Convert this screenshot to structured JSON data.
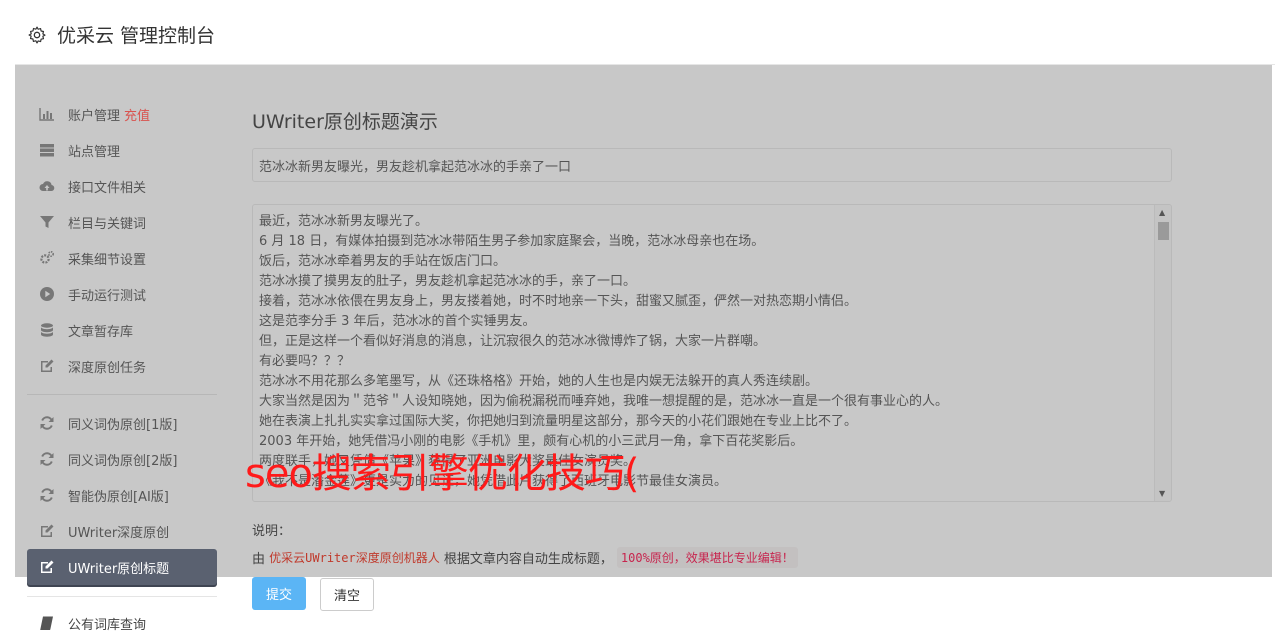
{
  "header": {
    "title": "优采云 管理控制台",
    "icon": "gear-icon"
  },
  "sidebar": {
    "groups": [
      [
        {
          "label": "账户管理",
          "badge": "充值",
          "icon": "bar-chart-icon"
        },
        {
          "label": "站点管理",
          "icon": "server-icon"
        },
        {
          "label": "接口文件相关",
          "icon": "cloud-upload-icon"
        },
        {
          "label": "栏目与关键词",
          "icon": "filter-icon"
        },
        {
          "label": "采集细节设置",
          "icon": "cogs-icon"
        },
        {
          "label": "手动运行测试",
          "icon": "play-circle-icon"
        },
        {
          "label": "文章暂存库",
          "icon": "database-icon"
        },
        {
          "label": "深度原创任务",
          "icon": "edit-icon"
        }
      ],
      [
        {
          "label": "同义词伪原创[1版]",
          "icon": "refresh-icon"
        },
        {
          "label": "同义词伪原创[2版]",
          "icon": "refresh-icon"
        },
        {
          "label": "智能伪原创[AI版]",
          "icon": "refresh-icon"
        },
        {
          "label": "UWriter深度原创",
          "icon": "edit-icon"
        },
        {
          "label": "UWriter原创标题",
          "icon": "edit-icon",
          "active": true
        }
      ]
    ],
    "bottom": {
      "label": "公有词库查询",
      "icon": "book-icon"
    }
  },
  "main": {
    "page_title": "UWriter原创标题演示",
    "title_value": "范冰冰新男友曝光，男友趁机拿起范冰冰的手亲了一口",
    "body_lines": [
      "最近，范冰冰新男友曝光了。",
      "6 月 18 日，有媒体拍摄到范冰冰带陌生男子参加家庭聚会，当晚，范冰冰母亲也在场。",
      "饭后，范冰冰牵着男友的手站在饭店门口。",
      "范冰冰摸了摸男友的肚子，男友趁机拿起范冰冰的手，亲了一口。",
      "接着，范冰冰依偎在男友身上，男友搂着她，时不时地亲一下头，甜蜜又腻歪，俨然一对热恋期小情侣。",
      "这是范李分手 3 年后，范冰冰的首个实锤男友。",
      "但，正是这样一个看似好消息的消息，让沉寂很久的范冰冰微博炸了锅，大家一片群嘲。",
      "有必要吗？？？",
      "范冰冰不用花那么多笔墨写，从《还珠格格》开始，她的人生也是内娱无法躲开的真人秀连续剧。",
      "大家当然是因为＂范爷＂人设知晓她，因为偷税漏税而唾弃她，我唯一想提醒的是，范冰冰一直是一个很有事业心的人。",
      "她在表演上扎扎实实拿过国际大奖，你把她归到流量明星这部分，那今天的小花们跟她在专业上比不了。",
      "2003 年开始，她凭借冯小刚的电影《手机》里，颇有心机的小三武月一角，拿下百花奖影后。",
      "两度联手，她又凭借《苹果》获得了亚洲电影大奖最佳女演员奖。",
      "《我不是潘金莲》更是实力的见证，她凭借此片获得了西班牙电影节最佳女演员。"
    ],
    "watermark": "seo搜索引擎优化技巧(",
    "note_label": "说明：",
    "note_prefix": "由",
    "note_highlight": "优采云UWriter深度原创机器人",
    "note_middle": "根据文章内容自动生成标题，",
    "note_code": "100%原创，效果堪比专业编辑！",
    "submit_label": "提交",
    "clear_label": "清空"
  }
}
